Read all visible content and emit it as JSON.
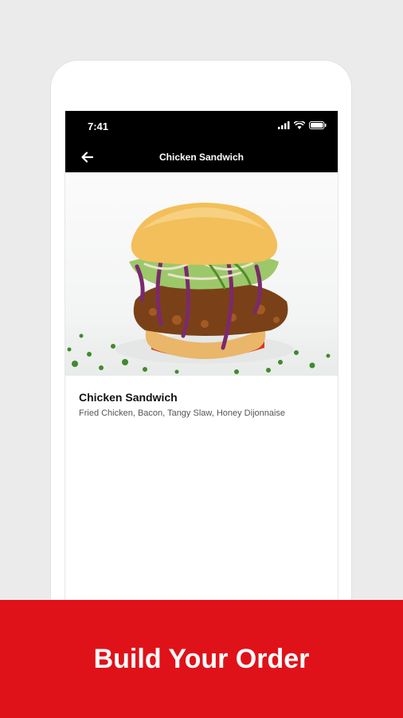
{
  "status_bar": {
    "time": "7:41"
  },
  "app_bar": {
    "title": "Chicken Sandwich"
  },
  "item": {
    "name": "Chicken Sandwich",
    "description": "Fried Chicken, Bacon, Tangy Slaw, Honey Dijonnaise"
  },
  "cta": {
    "label": "Build Your Order"
  },
  "colors": {
    "accent": "#e01219",
    "background": "#ebebeb",
    "bar": "#000000"
  },
  "icons": [
    "signal-icon",
    "wifi-icon",
    "battery-icon",
    "back-arrow-icon"
  ]
}
